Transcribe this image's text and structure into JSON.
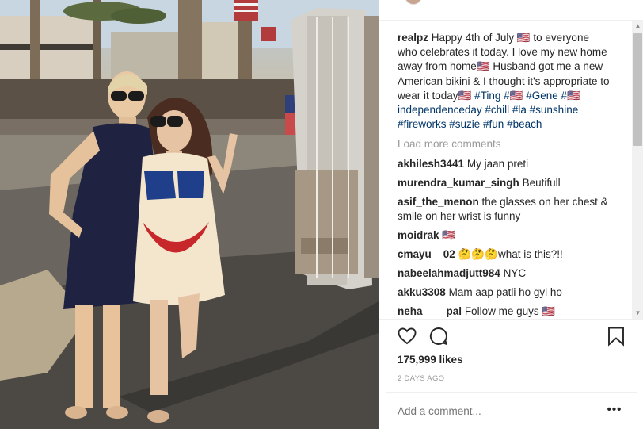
{
  "post": {
    "caption": {
      "username": "realpz",
      "text": "Happy 4th of July 🇺🇸 to everyone who celebrates it today. I love my new home away from home🇺🇸 Husband got me a new American bikini & I thought it's appropriate to wear it today🇺🇸",
      "hashtags": [
        "#Ting #🇺🇸",
        "#Gene #🇺🇸independenceday #chill #la",
        "#sunshine #fireworks #suzie #fun #beach"
      ]
    },
    "load_more_label": "Load more comments",
    "comments": [
      {
        "user": "akhilesh3441",
        "text": "My jaan preti"
      },
      {
        "user": "murendra_kumar_singh",
        "text": "Beutifull"
      },
      {
        "user": "asif_the_menon",
        "text": "the glasses on her chest & smile on her wrist is funny"
      },
      {
        "user": "moidrak",
        "text": "🇺🇸"
      },
      {
        "user": "cmayu__02",
        "text": "🤔🤔🤔what is this?!!"
      },
      {
        "user": "nabeelahmadjutt984",
        "text": "NYC"
      },
      {
        "user": "akku3308",
        "text": "Mam aap patli ho gyi ho"
      },
      {
        "user": "neha____pal",
        "text": "Follow me guys 🇺🇸"
      }
    ],
    "likes": "175,999 likes",
    "timestamp": "2 DAYS AGO",
    "add_comment_placeholder": "Add a comment...",
    "more_options": "•••"
  },
  "icons": {
    "like": "heart-icon",
    "comment": "comment-icon",
    "save": "bookmark-icon"
  }
}
